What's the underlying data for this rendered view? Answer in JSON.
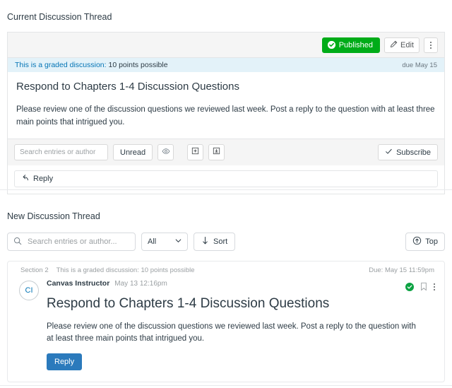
{
  "sections": {
    "current": {
      "label": "Current Discussion Thread"
    },
    "new": {
      "label": "New Discussion Thread"
    }
  },
  "classic_card": {
    "toolbar": {
      "published_label": "Published",
      "published_icon": "check-circle-icon",
      "published_color": "#00AC18",
      "edit_label": "Edit",
      "edit_icon": "pencil-icon",
      "more_label": "More options",
      "more_icon": "kebab-menu-icon"
    },
    "graded_banner": {
      "link_text": "This is a graded discussion:",
      "points_text": " 10 points possible",
      "due_text": "due May 15",
      "background": "#E3F2F9",
      "link_color": "#0374B5"
    },
    "title": "Respond to Chapters 1-4 Discussion Questions",
    "message": "Please review one of the discussion questions we reviewed last week. Post a reply to the question with at least three main points that intrigued you.",
    "filterbar": {
      "search_placeholder": "Search entries or author",
      "search_value": "",
      "unread_label": "Unread",
      "eye_icon": "eye-icon",
      "expand_icon": "expand-threads-icon",
      "collapse_icon": "collapse-threads-icon",
      "subscribe_label": "Subscribe",
      "subscribe_icon": "check-icon"
    },
    "reply": {
      "label": "Reply",
      "icon": "reply-arrow-icon"
    }
  },
  "new_thread": {
    "toolbar": {
      "search_placeholder": "Search entries or author...",
      "search_value": "",
      "search_icon": "search-icon",
      "filter_value": "All",
      "filter_icon": "chevron-down-icon",
      "sort_label": "Sort",
      "sort_icon": "arrow-down-icon",
      "top_label": "Top",
      "top_icon": "arrow-up-circle-icon"
    },
    "post": {
      "section": "Section 2",
      "graded_text": "This is a graded discussion: 10 points possible",
      "due_text": "Due: May 15 11:59pm",
      "avatar_initials": "CI",
      "avatar_color": "#0374B5",
      "author": "Canvas Instructor",
      "timestamp": "May 13 12:16pm",
      "title": "Respond to Chapters 1-4 Discussion Questions",
      "message": "Please review one of the discussion questions we reviewed last week. Post a reply to the question with at least three main points that intrigued you.",
      "reply_label": "Reply",
      "reply_color": "#2B7ABC",
      "actions": {
        "read_state_icon": "check-circle-filled-icon",
        "read_state_color": "#0CA242",
        "bookmark_icon": "bookmark-icon",
        "more_icon": "kebab-menu-icon"
      }
    }
  }
}
